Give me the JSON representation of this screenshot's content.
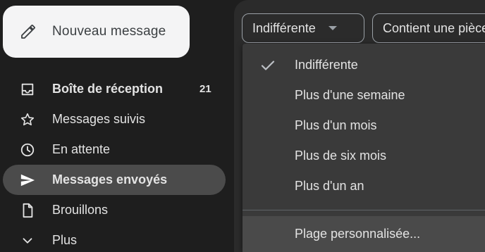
{
  "sidebar": {
    "compose_label": "Nouveau message",
    "items": [
      {
        "label": "Boîte de réception",
        "count": "21",
        "icon": "inbox-icon"
      },
      {
        "label": "Messages suivis",
        "icon": "star-icon"
      },
      {
        "label": "En attente",
        "icon": "clock-icon"
      },
      {
        "label": "Messages envoyés",
        "icon": "send-icon"
      },
      {
        "label": "Brouillons",
        "icon": "draft-icon"
      },
      {
        "label": "Plus",
        "icon": "chevron-down-icon"
      }
    ]
  },
  "filters": {
    "date_chip": "Indifférente",
    "attachment_chip": "Contient une pièce jointe"
  },
  "date_menu": {
    "selected": "Indifférente",
    "options": [
      "Indifférente",
      "Plus d'une semaine",
      "Plus d'un mois",
      "Plus de six mois",
      "Plus d'un an",
      "Plage personnalisée..."
    ]
  },
  "colors": {
    "background": "#1e1e1e",
    "active_item": "#4b4b4b",
    "compose_bg": "#f4f4f5",
    "menu_bg": "#3a3a3a"
  }
}
